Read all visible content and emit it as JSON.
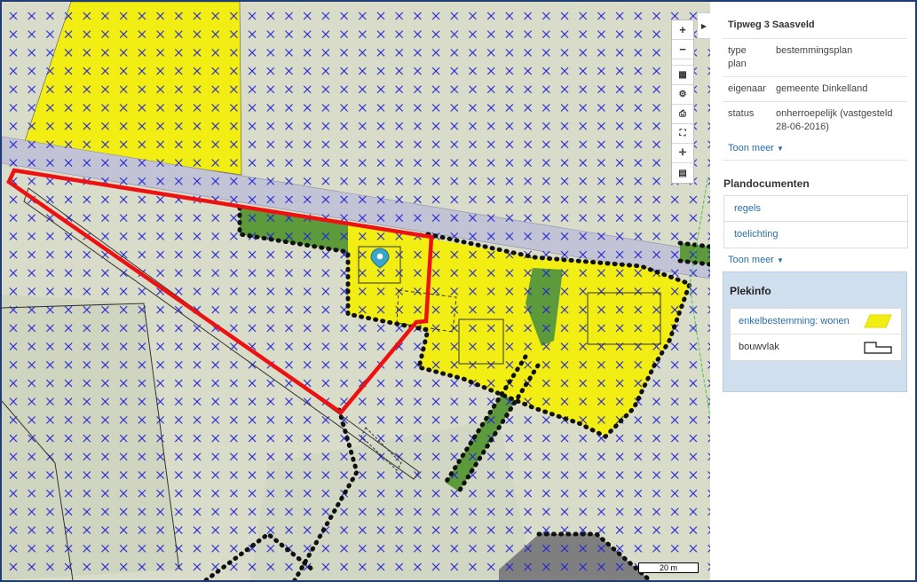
{
  "info": {
    "title": "Tipweg 3 Saasveld",
    "props": [
      {
        "key": "type plan",
        "value": "bestemmingsplan"
      },
      {
        "key": "eigenaar",
        "value": "gemeente Dinkelland"
      },
      {
        "key": "status",
        "value": "onherroepelijk (vastgesteld 28-06-2016)"
      }
    ],
    "toon_meer": "Toon meer"
  },
  "documents": {
    "heading": "Plandocumenten",
    "items": [
      "regels",
      "toelichting"
    ],
    "toon_meer": "Toon meer"
  },
  "plekinfo": {
    "heading": "Plekinfo",
    "items": [
      {
        "label": "enkelbestemming: wonen",
        "symbol": "yellow-parallelogram"
      },
      {
        "label": "bouwvlak",
        "symbol": "outline-step-shape"
      }
    ]
  },
  "map": {
    "scale_label": "20 m",
    "toolbar": [
      {
        "name": "zoom-in",
        "glyph": "+"
      },
      {
        "name": "zoom-out",
        "glyph": "−"
      },
      {
        "name": "layers",
        "glyph": "▦"
      },
      {
        "name": "settings",
        "glyph": "⚙"
      },
      {
        "name": "print",
        "glyph": "⎙"
      },
      {
        "name": "fullscreen",
        "glyph": "⛶"
      },
      {
        "name": "locate",
        "glyph": "✛"
      },
      {
        "name": "legend",
        "glyph": "▤"
      }
    ],
    "colors": {
      "background": "#d8dcc8",
      "cross_hatch": "#1f1fd6",
      "yellow_zone": "#f2ee13",
      "green_zone": "#5c9a3b",
      "road": "#c3c3d6",
      "plan_boundary": "#ee1111",
      "dark_area": "#7f7f7f"
    }
  }
}
